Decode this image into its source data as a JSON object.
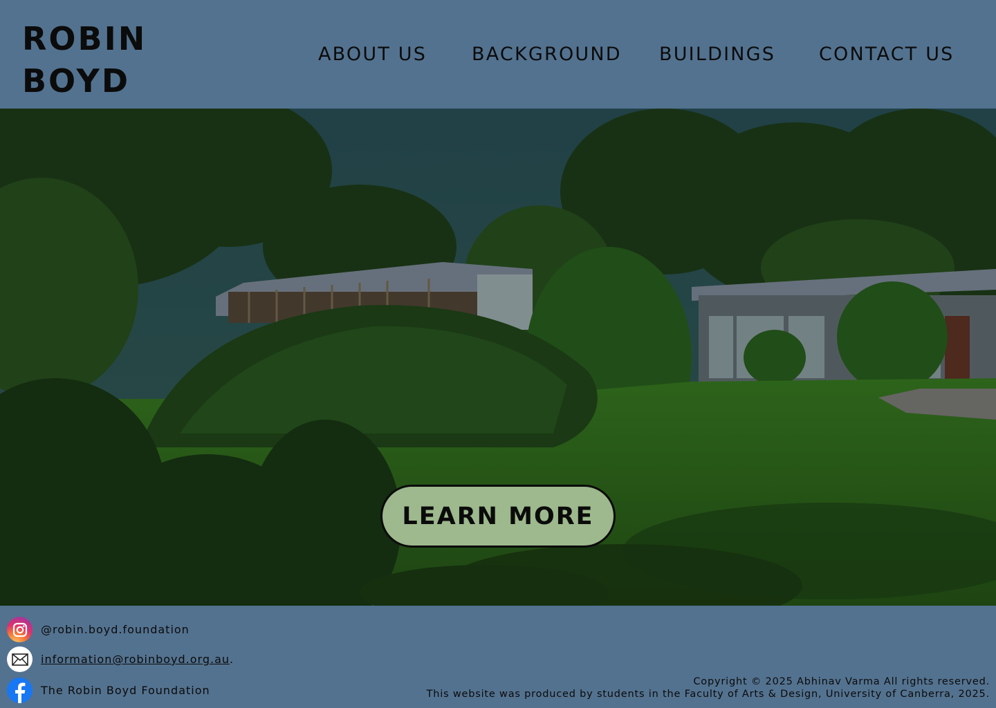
{
  "header": {
    "logo_line1": "ROBIN",
    "logo_line2": "BOYD",
    "nav": {
      "about": "ABOUT US",
      "background": "BACKGROUND",
      "buildings": "BUILDINGS",
      "contact": "CONTACT US"
    }
  },
  "hero": {
    "image": "house-in-garden-photo",
    "cta_label": "LEARN MORE"
  },
  "footer": {
    "instagram": {
      "icon": "instagram-icon",
      "handle": "@robin.boyd.foundation"
    },
    "email": {
      "icon": "mail-icon",
      "address": "information@robinboyd.org.au",
      "suffix": "."
    },
    "facebook": {
      "icon": "facebook-icon",
      "name": "The Robin Boyd Foundation"
    },
    "copyright": "Copyright © 2025 Abhinav Varma All rights reserved.",
    "credit": "This website was produced by students in the Faculty of Arts & Design, University of Canberra, 2025."
  },
  "colors": {
    "background": "#53728f",
    "button": "#9db98d",
    "text": "#0b0b0b"
  }
}
